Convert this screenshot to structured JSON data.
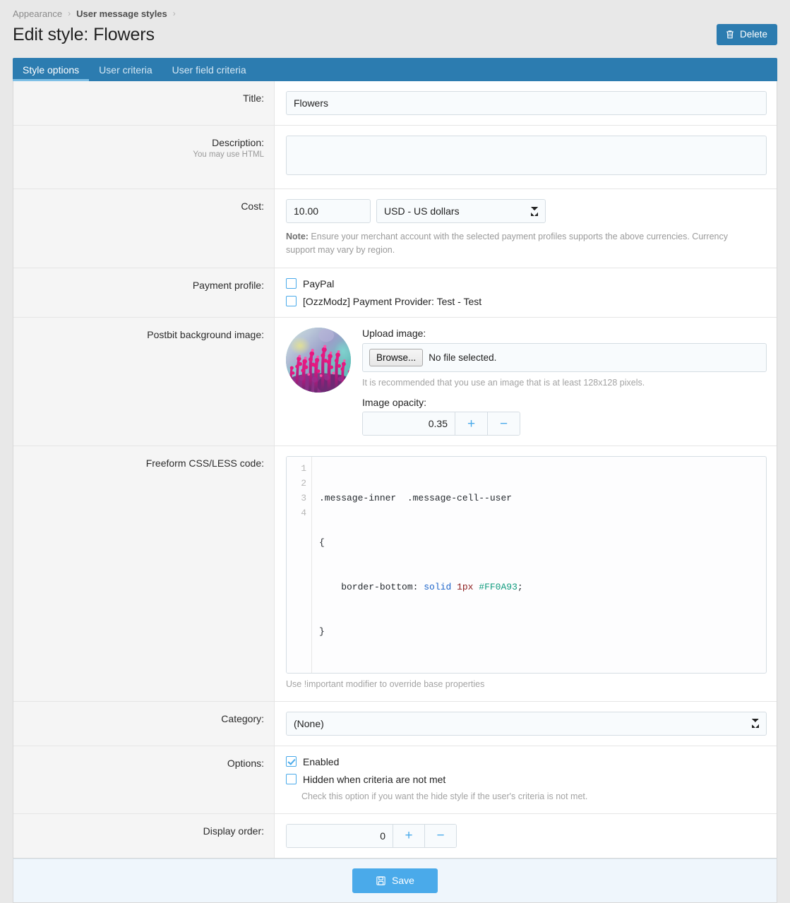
{
  "breadcrumb": {
    "items": [
      {
        "label": "Appearance",
        "strong": false
      },
      {
        "label": "User message styles",
        "strong": true
      }
    ],
    "separator": "›"
  },
  "header": {
    "title": "Edit style: Flowers",
    "delete_label": "Delete",
    "delete_icon": "trash-icon"
  },
  "tabs": [
    {
      "label": "Style options",
      "active": true
    },
    {
      "label": "User criteria",
      "active": false
    },
    {
      "label": "User field criteria",
      "active": false
    }
  ],
  "form": {
    "title": {
      "label": "Title:",
      "value": "Flowers"
    },
    "description": {
      "label": "Description:",
      "sublabel": "You may use HTML",
      "value": ""
    },
    "cost": {
      "label": "Cost:",
      "value": "10.00",
      "currency_selected": "USD - US dollars",
      "currency_options": [
        "USD - US dollars"
      ],
      "note_prefix": "Note:",
      "note_text": " Ensure your merchant account with the selected payment profiles supports the above currencies. Currency support may vary by region."
    },
    "payment_profile": {
      "label": "Payment profile:",
      "options": [
        {
          "label": "PayPal",
          "checked": false
        },
        {
          "label": "[OzzModz] Payment Provider: Test - Test",
          "checked": false
        }
      ]
    },
    "postbit_image": {
      "label": "Postbit background image:",
      "thumb_alt": "flowers-thumbnail",
      "upload_label": "Upload image:",
      "browse_label": "Browse...",
      "file_status": "No file selected.",
      "recommend_text": "It is recommended that you use an image that is at least 128x128 pixels.",
      "opacity_label": "Image opacity:",
      "opacity_value": "0.35",
      "plus_label": "+",
      "minus_label": "−"
    },
    "freeform_css": {
      "label": "Freeform CSS/LESS code:",
      "line_numbers": [
        "1",
        "2",
        "3",
        "4"
      ],
      "lines": [
        {
          "plain": ".message-inner  .message-cell--user"
        },
        {
          "plain": "{"
        },
        {
          "prop": "    border-bottom: ",
          "kw": "solid",
          "space1": " ",
          "num": "1px",
          "space2": " ",
          "color": "#FF0A93",
          "semi": ";"
        },
        {
          "plain": "}"
        }
      ],
      "hint": "Use !important modifier to override base properties"
    },
    "category": {
      "label": "Category:",
      "selected": "(None)",
      "options": [
        "(None)"
      ]
    },
    "options": {
      "label": "Options:",
      "items": [
        {
          "label": "Enabled",
          "checked": true,
          "hint": ""
        },
        {
          "label": "Hidden when criteria are not met",
          "checked": false,
          "hint": "Check this option if you want the hide style if the user's criteria is not met."
        }
      ]
    },
    "display_order": {
      "label": "Display order:",
      "value": "0",
      "plus_label": "+",
      "minus_label": "−"
    }
  },
  "footer": {
    "save_label": "Save",
    "save_icon": "save-floppy-icon"
  },
  "colors": {
    "accent_dark_blue": "#2c7cb0",
    "accent_blue": "#4aaaea",
    "page_bg": "#e8e8e8",
    "label_bg": "#f5f5f5",
    "input_bg": "#f8fbfd",
    "footer_bg": "#eff6fc",
    "css_color_literal": "#FF0A93"
  }
}
